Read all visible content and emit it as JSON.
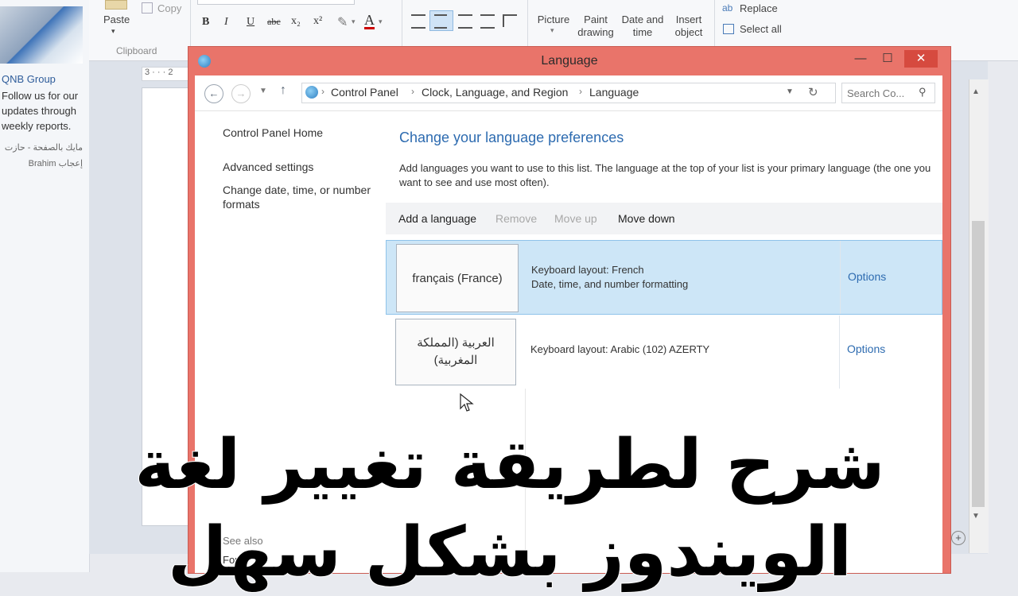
{
  "left_strip": {
    "post_title": "QNB Group",
    "post_body": "Follow us for our updates through weekly reports.",
    "post_meta_ar_1": "مايك بالصفحة - حازت",
    "post_meta_ar_2": "إعجاب Brahim"
  },
  "ribbon": {
    "paste_label": "Paste",
    "copy_label": "Copy",
    "clipboard_group": "Clipboard",
    "bold": "B",
    "italic": "I",
    "underline": "U",
    "strike": "abc",
    "subscript": "x₂",
    "superscript": "x²",
    "picture_label": "Picture",
    "paint_label": "Paint drawing",
    "datetime_label": "Date and time",
    "insert_object_label": "Insert object",
    "replace_label": "Replace",
    "select_all_label": "Select all",
    "ruler_text": "3 · · · 2"
  },
  "window": {
    "title": "Language",
    "min_glyph": "—",
    "max_glyph": "☐",
    "close_glyph": "✕",
    "breadcrumbs": [
      "Control Panel",
      "Clock, Language, and Region",
      "Language"
    ],
    "search_placeholder": "Search Co...",
    "left_pane": {
      "home": "Control Panel Home",
      "advanced": "Advanced settings",
      "change_formats": "Change date, time, or number formats",
      "see_also": "See also",
      "fonts": "Fonts"
    },
    "heading": "Change your language preferences",
    "description": "Add languages you want to use to this list. The language at the top of your list is your primary language (the one you want to see and use most often).",
    "toolbar": {
      "add": "Add a language",
      "remove": "Remove",
      "move_up": "Move up",
      "move_down": "Move down"
    },
    "languages": [
      {
        "name": "français (France)",
        "keyboard": "Keyboard layout: French",
        "extra": "Date, time, and number formatting",
        "options": "Options"
      },
      {
        "name": "العربية (المملكة المغربية)",
        "keyboard": "Keyboard layout: Arabic (102) AZERTY",
        "extra": "",
        "options": "Options"
      }
    ]
  },
  "caption": "شرح لطريقة تغيير لغة الويندوز بشكل سهل",
  "colors": {
    "accent": "#2d6bb0",
    "window_frame": "#e9746a",
    "selected_row": "#cde6f7"
  }
}
